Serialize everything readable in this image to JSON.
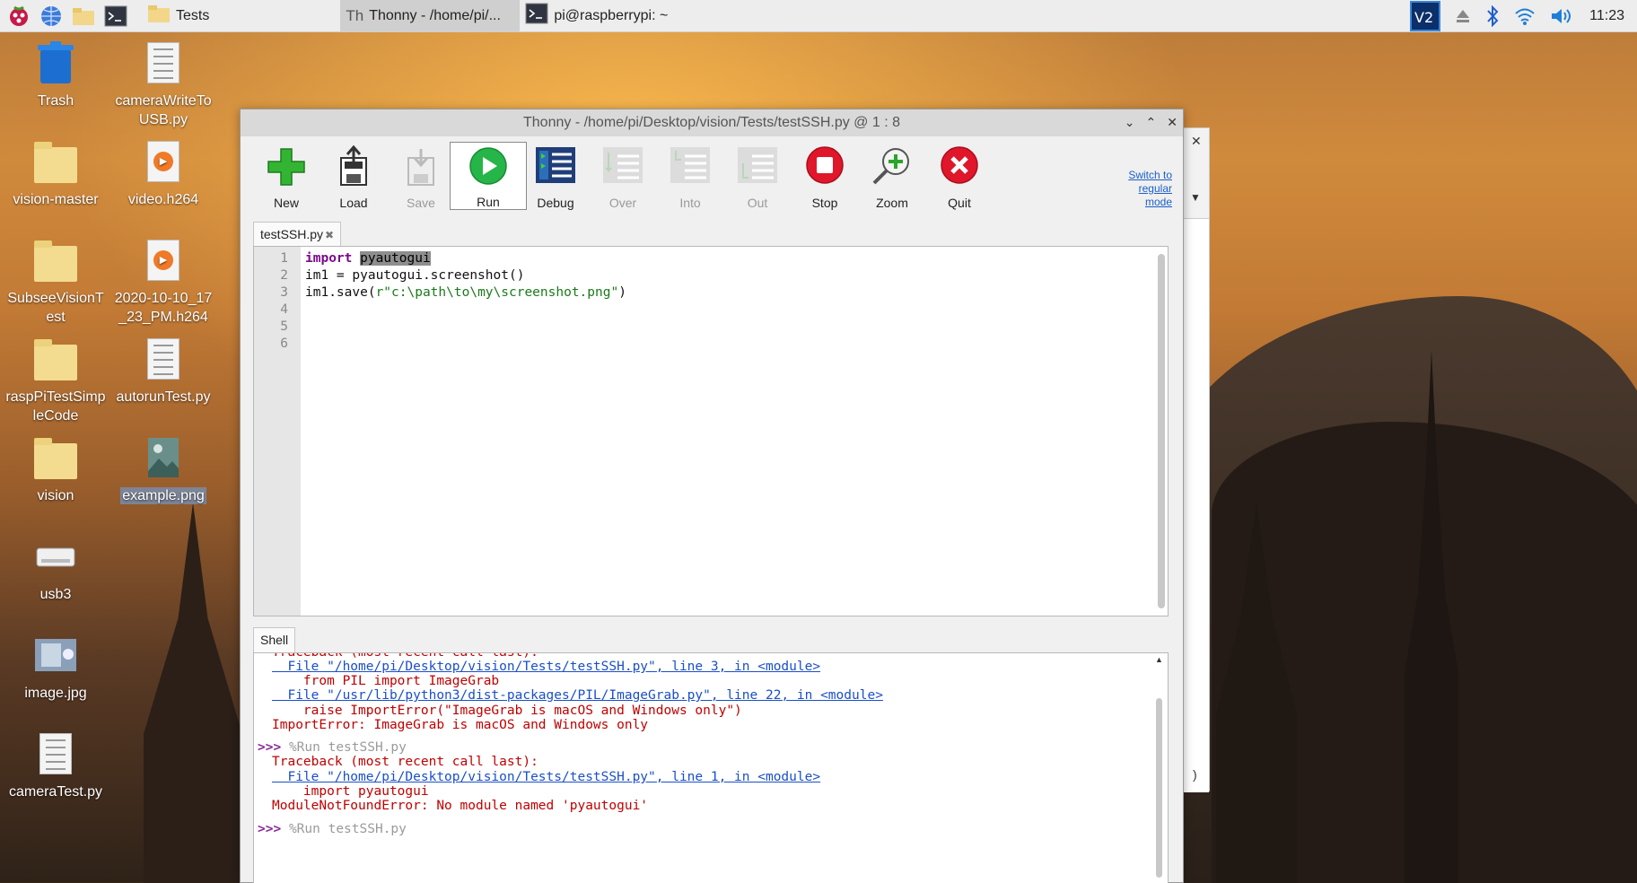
{
  "taskbar": {
    "tasks": [
      {
        "label": "Tests",
        "icon": "folder-icon"
      },
      {
        "label": "Thonny  -  /home/pi/...",
        "icon": "thonny-icon"
      },
      {
        "label": "pi@raspberrypi: ~",
        "icon": "terminal-icon"
      }
    ],
    "clock": "11:23"
  },
  "desktop": {
    "icons": [
      {
        "label": "Trash"
      },
      {
        "label": "cameraWriteToUSB.py"
      },
      {
        "label": "vision-master"
      },
      {
        "label": "video.h264"
      },
      {
        "label": "SubseeVisionTest"
      },
      {
        "label": "2020-10-10_17_23_PM.h264"
      },
      {
        "label": "raspPiTestSimpleCode"
      },
      {
        "label": "autorunTest.py"
      },
      {
        "label": "vision"
      },
      {
        "label": "example.png"
      },
      {
        "label": "usb3"
      },
      {
        "label": "image.jpg"
      },
      {
        "label": "cameraTest.py"
      }
    ]
  },
  "window": {
    "title": "Thonny  -  /home/pi/Desktop/vision/Tests/testSSH.py  @  1 : 8",
    "toolbar": [
      {
        "label": "New",
        "enabled": true
      },
      {
        "label": "Load",
        "enabled": true
      },
      {
        "label": "Save",
        "enabled": false
      },
      {
        "label": "Run",
        "enabled": true
      },
      {
        "label": "Debug",
        "enabled": true
      },
      {
        "label": "Over",
        "enabled": false
      },
      {
        "label": "Into",
        "enabled": false
      },
      {
        "label": "Out",
        "enabled": false
      },
      {
        "label": "Stop",
        "enabled": true
      },
      {
        "label": "Zoom",
        "enabled": true
      },
      {
        "label": "Quit",
        "enabled": true
      }
    ],
    "switch_mode": [
      "Switch to",
      "regular",
      "mode"
    ],
    "editor_tab": "testSSH.py",
    "line_numbers": [
      "1",
      "2",
      "3",
      "4",
      "5",
      "6"
    ],
    "code": {
      "l1_kw": "import",
      "l1_mod": "pyautogui",
      "l2": "im1 = pyautogui.screenshot()",
      "l3_pre": "im1.save(",
      "l3_str": "r\"c:\\path\\to\\my\\screenshot.png\"",
      "l3_post": ")"
    },
    "shell_tab": "Shell",
    "shell": {
      "a0": "Traceback (most recent call last):",
      "a1": "  File \"/home/pi/Desktop/vision/Tests/testSSH.py\", line 3, in <module>",
      "a2": "    from PIL import ImageGrab",
      "a3": "  File \"/usr/lib/python3/dist-packages/PIL/ImageGrab.py\", line 22, in <module>",
      "a4": "    raise ImportError(\"ImageGrab is macOS and Windows only\")",
      "a5": "ImportError: ImageGrab is macOS and Windows only",
      "p1": ">>>",
      "c1": "%Run testSSH.py",
      "b0": "Traceback (most recent call last):",
      "b1": "  File \"/home/pi/Desktop/vision/Tests/testSSH.py\", line 1, in <module>",
      "b2": "    import pyautogui",
      "b3": "ModuleNotFoundError: No module named 'pyautogui'",
      "p2": ">>>",
      "c2": "%Run testSSH.py"
    }
  }
}
